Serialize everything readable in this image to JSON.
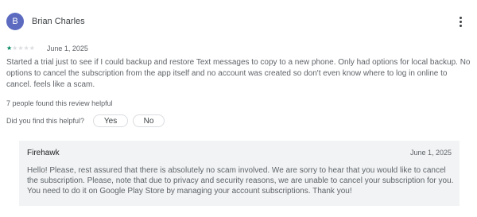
{
  "review": {
    "avatar_letter": "B",
    "avatar_color": "#5c6bc0",
    "author": "Brian Charles",
    "menu_icon": "more-vert-icon",
    "rating": 1,
    "max_rating": 5,
    "star_color": "#01875f",
    "date": "June 1, 2025",
    "text": "Started a trial just to see if I could backup and restore Text messages to copy to a new phone. Only had options for local backup. No options to cancel the subscription from the app itself and no account was created so don't even know where to log in online to cancel. feels like a scam.",
    "helpful_count": "7 people found this review helpful",
    "helpful_question": "Did you find this helpful?",
    "yes_label": "Yes",
    "no_label": "No"
  },
  "reply": {
    "author": "Firehawk",
    "date": "June 1, 2025",
    "text": "Hello! Please, rest assured that there is absolutely no scam involved. We are sorry to hear that you would like to cancel the subscription. Please, note that due to privacy and security reasons, we are unable to cancel your subscription for you. You need to do it on Google Play Store by managing your account subscriptions. Thank you!"
  }
}
